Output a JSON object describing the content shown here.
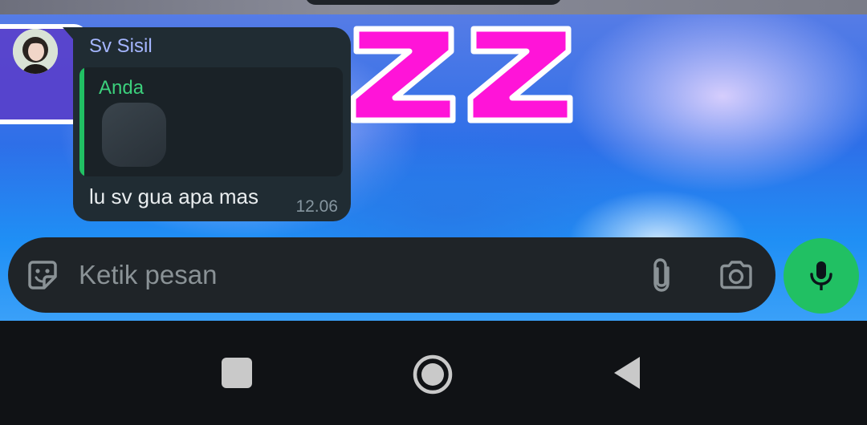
{
  "chat": {
    "message": {
      "sender": "Sv Sisil",
      "quoted_author": "Anda",
      "text": "lu sv gua apa mas",
      "time": "12.06"
    }
  },
  "composer": {
    "placeholder": "Ketik pesan",
    "icons": {
      "sticker": "sticker-icon",
      "attach": "paperclip-icon",
      "camera": "camera-icon",
      "mic": "microphone-icon"
    }
  },
  "navigation": {
    "icons": [
      "recents-square-icon",
      "home-circle-icon",
      "back-triangle-icon"
    ]
  },
  "colors": {
    "bubble": "#202c33",
    "sender_name": "#a5b6ff",
    "quote_accent": "#21c063",
    "mic_button": "#21c063"
  }
}
